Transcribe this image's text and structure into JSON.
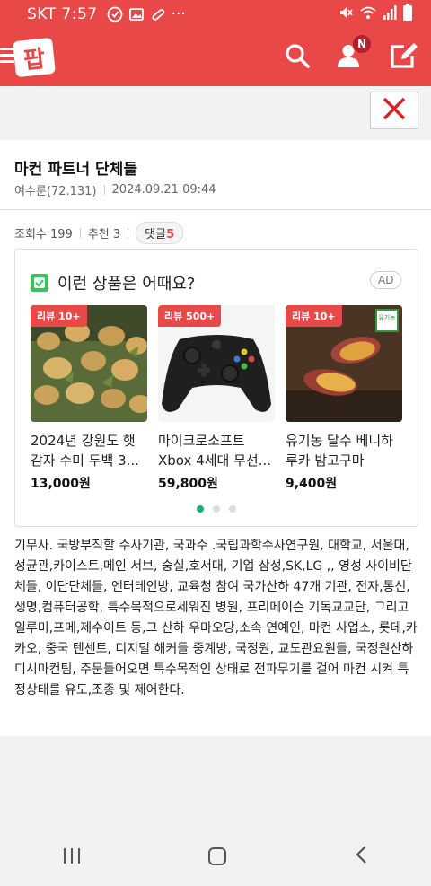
{
  "status_bar": {
    "carrier": "SKT",
    "time": "7:57",
    "more": "···"
  },
  "app_bar": {
    "logo_text": "팝",
    "notification_badge": "N"
  },
  "post": {
    "title": "마컨 파트너 단체들",
    "author": "여수룬(72.131)",
    "datetime": "2024.09.21 09:44",
    "views_label": "조회수 199",
    "recommend_label": "추천 3",
    "comment_label": "댓글",
    "comment_count": "5",
    "body": "기무사. 국방부직할 수사기관, 국과수 .국립과학수사연구원, 대학교, 서울대,성균관,카이스트,메인 서브, 숭실,호서대, 기업 삼성,SK,LG ,, 영성 사이비단체들, 이단단체들, 엔터테인방, 교육청 참여 국가산하 47개 기관, 전자,통신,생명,컴퓨터공학, 특수목적으로세워진 병원, 프리메이슨 기독교교단, 그리고 일루미,프메,제수이트 등,그 산하 우마오당,소속 연예인, 마컨 사업소, 롯데,카카오, 중국 텐센트, 디지털 해커들 중계방, 국정원, 교도관요원들, 국정원산하 디시마컨팀, 주문들어오면 특수목적인 상태로 전파무기를 걸어 마컨 시켜 특정상태를 유도,조종 및 제어한다."
  },
  "ad": {
    "heading": "이런 상품은 어때요?",
    "badge": "AD",
    "products": [
      {
        "review_badge": "리뷰 10+",
        "name": "2024년 강원도 햇감자 수미 두백 3...",
        "price": "13,000원"
      },
      {
        "review_badge": "리뷰 500+",
        "name": "마이크로소프트 Xbox 4세대 무선...",
        "price": "59,800원"
      },
      {
        "review_badge": "리뷰 10+",
        "name": "유기농 달수 베니하루카 밤고구마",
        "price": "9,400원",
        "organic_label": "유기농"
      }
    ],
    "page_count": 3,
    "active_page": 1
  },
  "colors": {
    "brand": "#e84848",
    "dot_active": "#18b46b"
  },
  "icons": [
    "hamburger-icon",
    "search-icon",
    "user-icon",
    "edit-icon",
    "close-icon",
    "ad-app-icon",
    "nav-recents-icon",
    "nav-home-icon",
    "nav-back-icon"
  ]
}
